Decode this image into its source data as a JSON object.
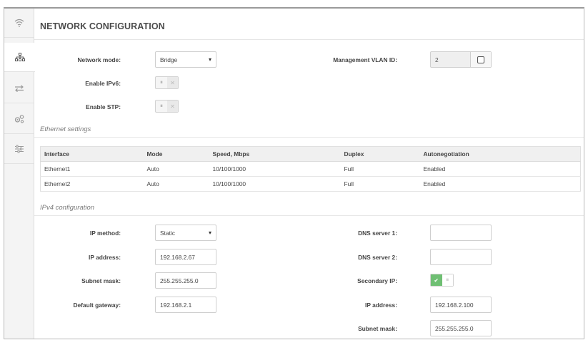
{
  "sidebar": {
    "items": [
      {
        "icon": "wifi-icon"
      },
      {
        "icon": "network-icon"
      },
      {
        "icon": "transfer-arrows-icon"
      },
      {
        "icon": "gears-icon"
      },
      {
        "icon": "sliders-icon"
      }
    ]
  },
  "page": {
    "title": "NETWORK CONFIGURATION"
  },
  "network": {
    "mode_label": "Network mode:",
    "mode_value": "Bridge",
    "vlan_label": "Management VLAN ID:",
    "vlan_value": "2",
    "ipv6_label": "Enable IPv6:",
    "stp_label": "Enable STP:",
    "ipv6_enabled": false,
    "stp_enabled": false
  },
  "ethernet": {
    "title": "Ethernet settings",
    "columns": [
      "Interface",
      "Mode",
      "Speed, Mbps",
      "Duplex",
      "Autonegotiation"
    ],
    "rows": [
      [
        "Ethernet1",
        "Auto",
        "10/100/1000",
        "Full",
        "Enabled"
      ],
      [
        "Ethernet2",
        "Auto",
        "10/100/1000",
        "Full",
        "Enabled"
      ]
    ]
  },
  "ipv4": {
    "title": "IPv4 configuration",
    "method_label": "IP method:",
    "method_value": "Static",
    "address_label": "IP address:",
    "address_value": "192.168.2.67",
    "mask_label": "Subnet mask:",
    "mask_value": "255.255.255.0",
    "gateway_label": "Default gateway:",
    "gateway_value": "192.168.2.1",
    "dns1_label": "DNS server 1:",
    "dns1_value": "",
    "dns2_label": "DNS server 2:",
    "dns2_value": "",
    "secondary_label": "Secondary IP:",
    "secondary_enabled": true,
    "sec_address_label": "IP address:",
    "sec_address_value": "192.168.2.100",
    "sec_mask_label": "Subnet mask:",
    "sec_mask_value": "255.255.255.0"
  },
  "colors": {
    "toggle_on": "#6fbf73",
    "header_bg": "#f0f0f0",
    "sidebar_bg": "#f4f4f4"
  }
}
